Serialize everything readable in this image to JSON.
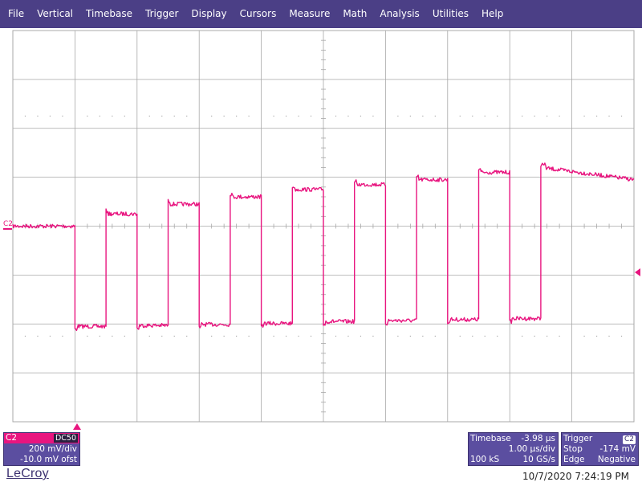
{
  "menu": [
    "File",
    "Vertical",
    "Timebase",
    "Trigger",
    "Display",
    "Cursors",
    "Measure",
    "Math",
    "Analysis",
    "Utilities",
    "Help"
  ],
  "colors": {
    "menubar": "#4b3f86",
    "trace": "#e8157f",
    "grid": "#a8a8a8",
    "panel": "#5b4ea0"
  },
  "trace_label": "C2",
  "channel": {
    "name": "C2",
    "coupling": "DC50",
    "scale": "200 mV/div",
    "offset": "-10.0 mV ofst"
  },
  "timebase": {
    "title": "Timebase",
    "delay": "-3.98 µs",
    "scale": "1.00 µs/div",
    "samples": "100 kS",
    "rate": "10 GS/s"
  },
  "trigger": {
    "title": "Trigger",
    "source": "C2",
    "mode": "Stop",
    "level": "-174 mV",
    "type": "Edge",
    "slope": "Negative"
  },
  "brand": "LeCroy",
  "timestamp": "10/7/2020 7:24:19 PM",
  "chart_data": {
    "type": "line",
    "grid": true,
    "divisions": {
      "x": 10,
      "y": 8
    },
    "xlim": [
      -5,
      5
    ],
    "ylim": [
      -4,
      4
    ],
    "x_unit": "div",
    "y_unit": "div",
    "series": [
      {
        "segments": [
          {
            "x0": -5.0,
            "x1": -4.0,
            "y": 0.0
          },
          {
            "x0": -4.0,
            "x1": -3.5,
            "y": -2.05
          },
          {
            "x0": -3.5,
            "x1": -3.0,
            "y": 0.25
          },
          {
            "x0": -3.0,
            "x1": -2.5,
            "y": -2.03
          },
          {
            "x0": -2.5,
            "x1": -2.0,
            "y": 0.45
          },
          {
            "x0": -2.0,
            "x1": -1.5,
            "y": -2.01
          },
          {
            "x0": -1.5,
            "x1": -1.0,
            "y": 0.6
          },
          {
            "x0": -1.0,
            "x1": -0.5,
            "y": -1.99
          },
          {
            "x0": -0.5,
            "x1": 0.0,
            "y": 0.75
          },
          {
            "x0": 0.0,
            "x1": 0.5,
            "y": -1.95
          },
          {
            "x0": 0.5,
            "x1": 1.0,
            "y": 0.85
          },
          {
            "x0": 1.0,
            "x1": 1.5,
            "y": -1.93
          },
          {
            "x0": 1.5,
            "x1": 2.0,
            "y": 0.95
          },
          {
            "x0": 2.0,
            "x1": 2.5,
            "y": -1.91
          },
          {
            "x0": 2.5,
            "x1": 3.0,
            "y": 1.1
          },
          {
            "x0": 3.0,
            "x1": 3.5,
            "y": -1.89
          },
          {
            "x0": 3.5,
            "x1": 5.0,
            "y": 1.2,
            "y_end": 0.95
          }
        ]
      }
    ]
  }
}
